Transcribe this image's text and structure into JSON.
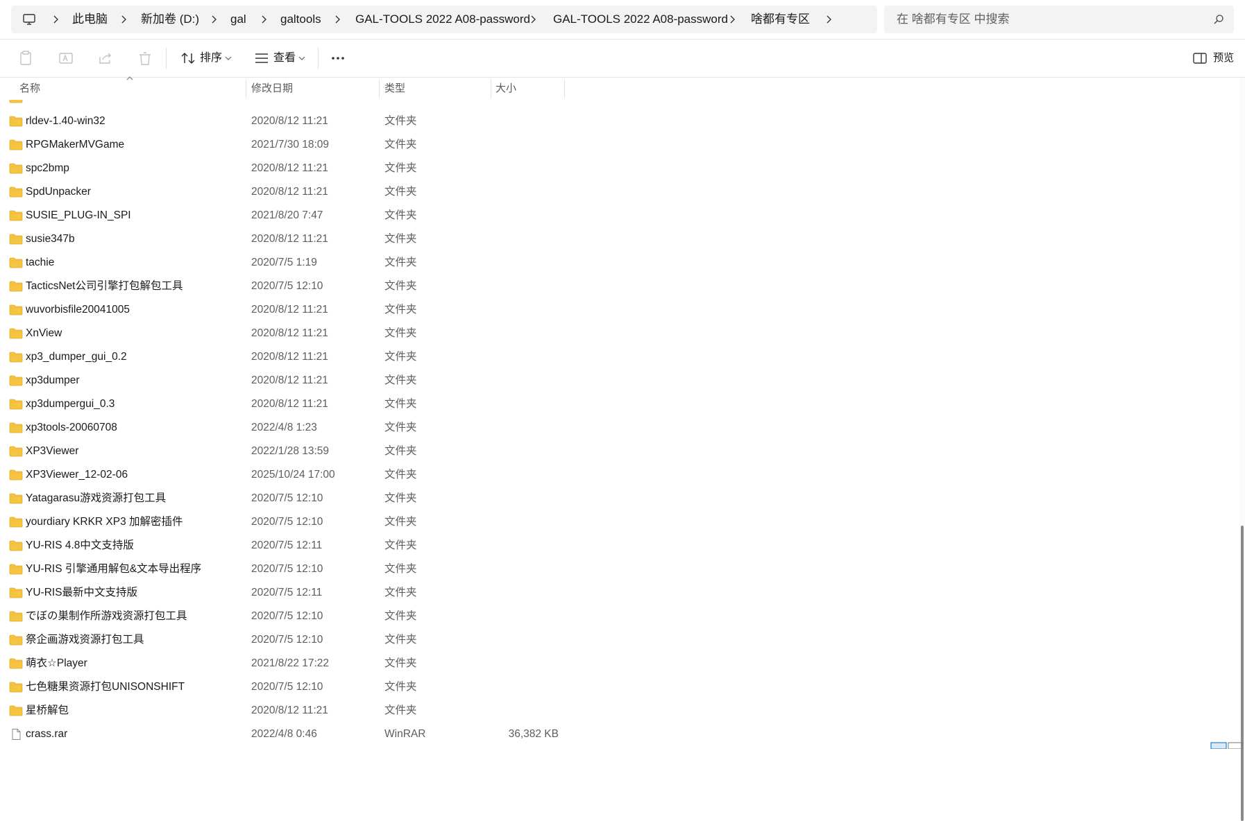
{
  "breadcrumb": {
    "items": [
      "此电脑",
      "新加卷 (D:)",
      "gal",
      "galtools",
      "GAL-TOOLS 2022 A08-password",
      "GAL-TOOLS 2022 A08-password",
      "啥都有专区"
    ]
  },
  "search": {
    "placeholder": "在 啥都有专区 中搜索"
  },
  "toolbar": {
    "sort_label": "排序",
    "view_label": "查看",
    "preview_label": "预览"
  },
  "columns": {
    "name": "名称",
    "modified": "修改日期",
    "type": "类型",
    "size": "大小"
  },
  "files": [
    {
      "name": "rldev-1.40-win32",
      "modified": "2020/8/12 11:21",
      "type": "文件夹",
      "size": ""
    },
    {
      "name": "RPGMakerMVGame",
      "modified": "2021/7/30 18:09",
      "type": "文件夹",
      "size": ""
    },
    {
      "name": "spc2bmp",
      "modified": "2020/8/12 11:21",
      "type": "文件夹",
      "size": ""
    },
    {
      "name": "SpdUnpacker",
      "modified": "2020/8/12 11:21",
      "type": "文件夹",
      "size": ""
    },
    {
      "name": "SUSIE_PLUG-IN_SPI",
      "modified": "2021/8/20 7:47",
      "type": "文件夹",
      "size": ""
    },
    {
      "name": "susie347b",
      "modified": "2020/8/12 11:21",
      "type": "文件夹",
      "size": ""
    },
    {
      "name": "tachie",
      "modified": "2020/7/5 1:19",
      "type": "文件夹",
      "size": ""
    },
    {
      "name": "TacticsNet公司引擎打包解包工具",
      "modified": "2020/7/5 12:10",
      "type": "文件夹",
      "size": ""
    },
    {
      "name": "wuvorbisfile20041005",
      "modified": "2020/8/12 11:21",
      "type": "文件夹",
      "size": ""
    },
    {
      "name": "XnView",
      "modified": "2020/8/12 11:21",
      "type": "文件夹",
      "size": ""
    },
    {
      "name": "xp3_dumper_gui_0.2",
      "modified": "2020/8/12 11:21",
      "type": "文件夹",
      "size": ""
    },
    {
      "name": "xp3dumper",
      "modified": "2020/8/12 11:21",
      "type": "文件夹",
      "size": ""
    },
    {
      "name": "xp3dumpergui_0.3",
      "modified": "2020/8/12 11:21",
      "type": "文件夹",
      "size": ""
    },
    {
      "name": "xp3tools-20060708",
      "modified": "2022/4/8 1:23",
      "type": "文件夹",
      "size": ""
    },
    {
      "name": "XP3Viewer",
      "modified": "2022/1/28 13:59",
      "type": "文件夹",
      "size": ""
    },
    {
      "name": "XP3Viewer_12-02-06",
      "modified": "2025/10/24 17:00",
      "type": "文件夹",
      "size": ""
    },
    {
      "name": "Yatagarasu游戏资源打包工具",
      "modified": "2020/7/5 12:10",
      "type": "文件夹",
      "size": ""
    },
    {
      "name": "yourdiary KRKR XP3 加解密插件",
      "modified": "2020/7/5 12:10",
      "type": "文件夹",
      "size": ""
    },
    {
      "name": "YU-RIS 4.8中文支持版",
      "modified": "2020/7/5 12:11",
      "type": "文件夹",
      "size": ""
    },
    {
      "name": "YU-RIS 引擎通用解包&文本导出程序",
      "modified": "2020/7/5 12:10",
      "type": "文件夹",
      "size": ""
    },
    {
      "name": "YU-RIS最新中文支持版",
      "modified": "2020/7/5 12:11",
      "type": "文件夹",
      "size": ""
    },
    {
      "name": "でぼの巣制作所游戏资源打包工具",
      "modified": "2020/7/5 12:10",
      "type": "文件夹",
      "size": ""
    },
    {
      "name": "祭企画游戏资源打包工具",
      "modified": "2020/7/5 12:10",
      "type": "文件夹",
      "size": ""
    },
    {
      "name": "萌衣☆Player",
      "modified": "2021/8/22 17:22",
      "type": "文件夹",
      "size": ""
    },
    {
      "name": "七色糖果资源打包UNISONSHIFT",
      "modified": "2020/7/5 12:10",
      "type": "文件夹",
      "size": ""
    },
    {
      "name": "星桥解包",
      "modified": "2020/8/12 11:21",
      "type": "文件夹",
      "size": ""
    },
    {
      "name": "crass.rar",
      "modified": "2022/4/8 0:46",
      "type": "WinRAR",
      "size": "36,382 KB",
      "is_file": true
    }
  ],
  "colors": {
    "folder": "#f5c542",
    "folder_dark": "#e0a82e",
    "accent": "#0067c0"
  }
}
